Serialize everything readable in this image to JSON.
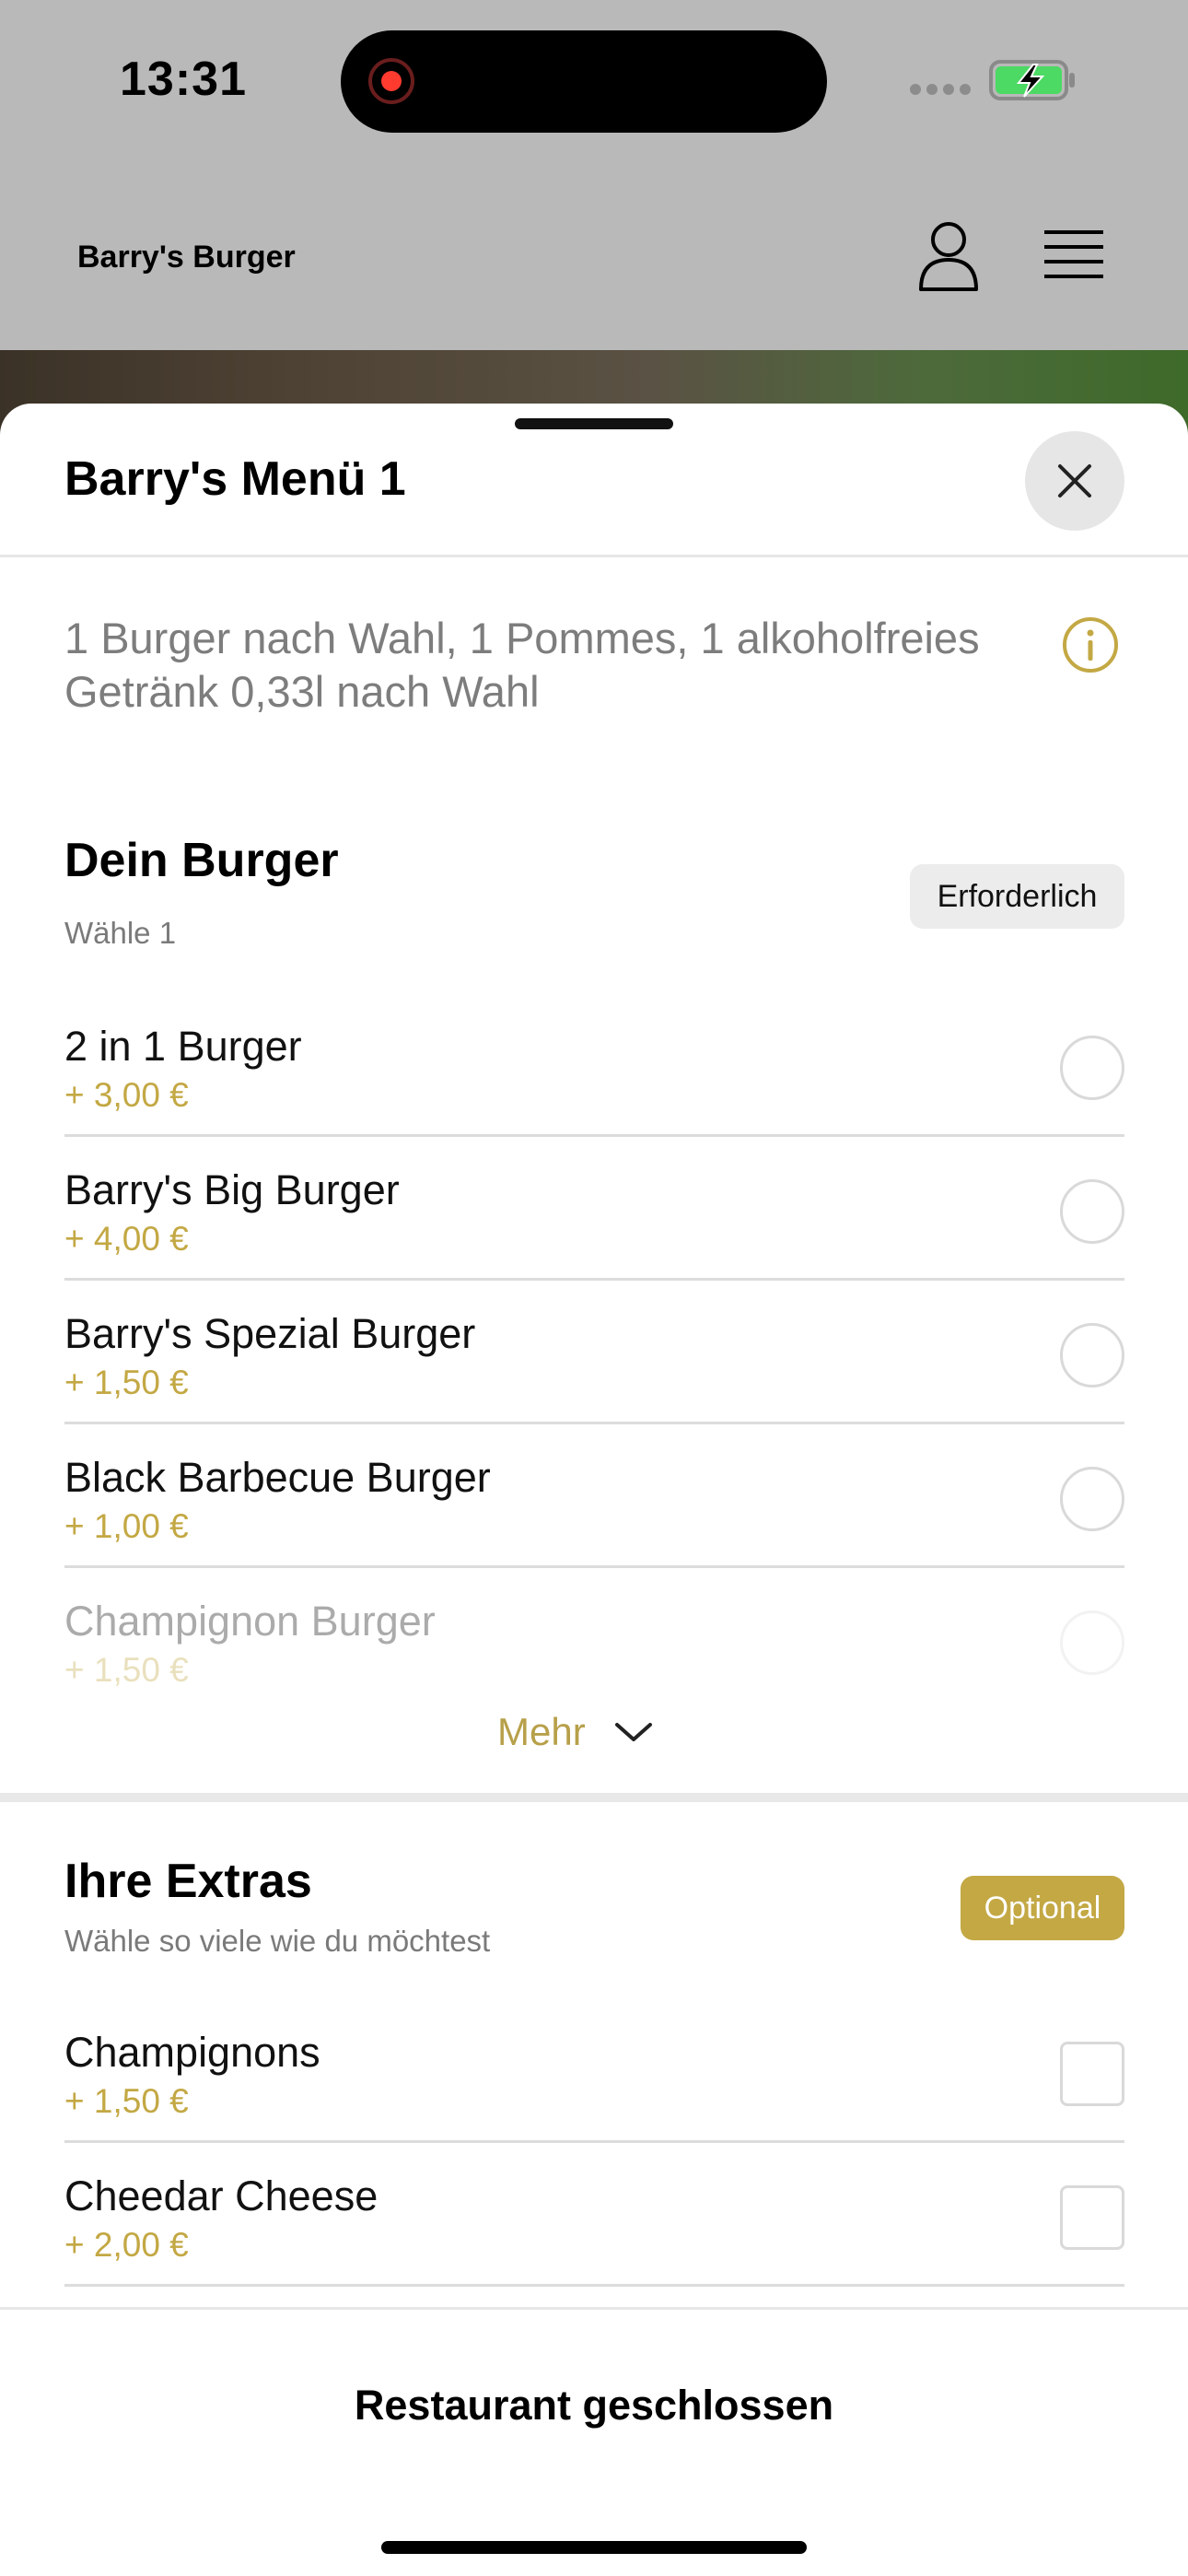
{
  "status_bar": {
    "time": "13:31",
    "recording_icon": "record-dot-icon",
    "battery_icon": "battery-charging-icon",
    "colors": {
      "record": "#ff3b30",
      "battery": "#4cd964"
    }
  },
  "header": {
    "brand": "Barry's Burger",
    "user_icon": "user-icon",
    "menu_icon": "hamburger-menu-icon"
  },
  "sheet": {
    "title": "Barry's Menü 1",
    "close_icon": "close-icon",
    "description": "1 Burger nach Wahl, 1 Pommes, 1 alkoholfreies Getränk 0,33l nach Wahl",
    "info_icon": "info-icon"
  },
  "burger_section": {
    "title": "Dein Burger",
    "subtitle": "Wähle 1",
    "badge": "Erforderlich",
    "options": [
      {
        "name": "2 in 1 Burger",
        "price": "+ 3,00 €"
      },
      {
        "name": "Barry's Big Burger",
        "price": "+ 4,00 €"
      },
      {
        "name": "Barry's Spezial Burger",
        "price": "+ 1,50 €"
      },
      {
        "name": "Black Barbecue Burger",
        "price": "+ 1,00 €"
      },
      {
        "name": "Champignon Burger",
        "price": "+ 1,50 €"
      }
    ],
    "more_label": "Mehr",
    "more_icon": "chevron-down-icon"
  },
  "extras_section": {
    "title": "Ihre Extras",
    "subtitle": "Wähle so viele wie du möchtest",
    "badge": "Optional",
    "options": [
      {
        "name": "Champignons",
        "price": "+ 1,50 €"
      },
      {
        "name": "Cheedar Cheese",
        "price": "+ 2,00 €"
      }
    ]
  },
  "footer": {
    "status": "Restaurant geschlossen"
  },
  "colors": {
    "accent": "#c3a844",
    "header_bg": "#b9b9b9"
  }
}
